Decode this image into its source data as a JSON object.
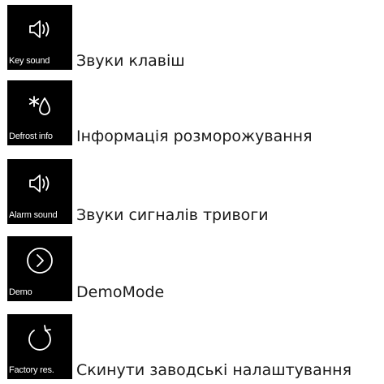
{
  "menu": {
    "items": [
      {
        "tile_caption": "Key sound",
        "label": "Звуки клавіш",
        "icon": "speaker-icon"
      },
      {
        "tile_caption": "Defrost info",
        "label": "Інформація розморожування",
        "icon": "defrost-drop-icon"
      },
      {
        "tile_caption": "Alarm sound",
        "label": "Звуки сигналів тривоги",
        "icon": "speaker-icon"
      },
      {
        "tile_caption": "Demo",
        "label": "DemoMode",
        "icon": "play-circle-icon"
      },
      {
        "tile_caption": "Factory res.",
        "label": "Скинути заводські налаштування",
        "icon": "reset-icon"
      }
    ]
  },
  "colors": {
    "tile_background": "#000000",
    "tile_foreground": "#ffffff",
    "label_text": "#1a1a1a"
  }
}
